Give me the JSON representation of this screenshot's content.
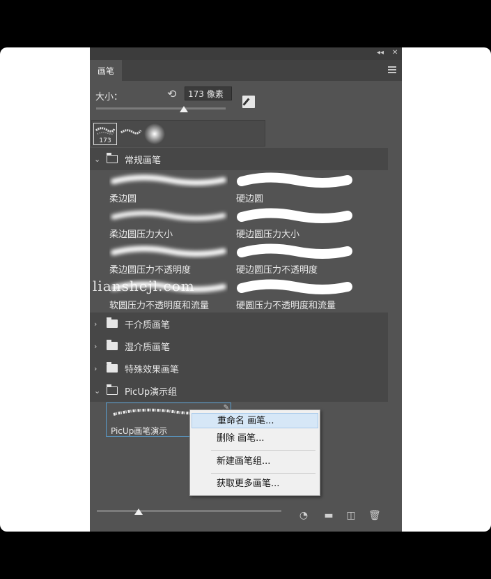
{
  "panel": {
    "tab_label": "画笔",
    "size_label": "大小：",
    "size_value": "173 像素",
    "selected_preset_size": "173"
  },
  "groups": [
    {
      "label": "常规画笔",
      "expanded": true
    },
    {
      "label": "干介质画笔",
      "expanded": false
    },
    {
      "label": "湿介质画笔",
      "expanded": false
    },
    {
      "label": "特殊效果画笔",
      "expanded": false
    },
    {
      "label": "PicUp演示组",
      "expanded": true
    }
  ],
  "brushes": {
    "soft_round": "柔边圆",
    "hard_round": "硬边圆",
    "soft_round_pressure_size": "柔边圆压力大小",
    "hard_round_pressure_size": "硬边圆压力大小",
    "soft_round_pressure_opacity": "柔边圆压力不透明度",
    "hard_round_pressure_opacity": "硬边圆压力不透明度",
    "soft_round_pressure_opacity_flow": "软圆压力不透明度和流量",
    "hard_round_pressure_opacity_flow": "硬圆压力不透明度和流量",
    "picup_demo": "PicUp画笔演示"
  },
  "context_menu": {
    "rename": "重命名 画笔...",
    "delete": "删除 画笔...",
    "new_group": "新建画笔组...",
    "get_more": "获取更多画笔..."
  },
  "watermark": "lianshejl.com",
  "colors": {
    "panel_bg": "#535353",
    "selection_border": "#5a9fd0",
    "menu_hover": "#d6e7f7"
  }
}
